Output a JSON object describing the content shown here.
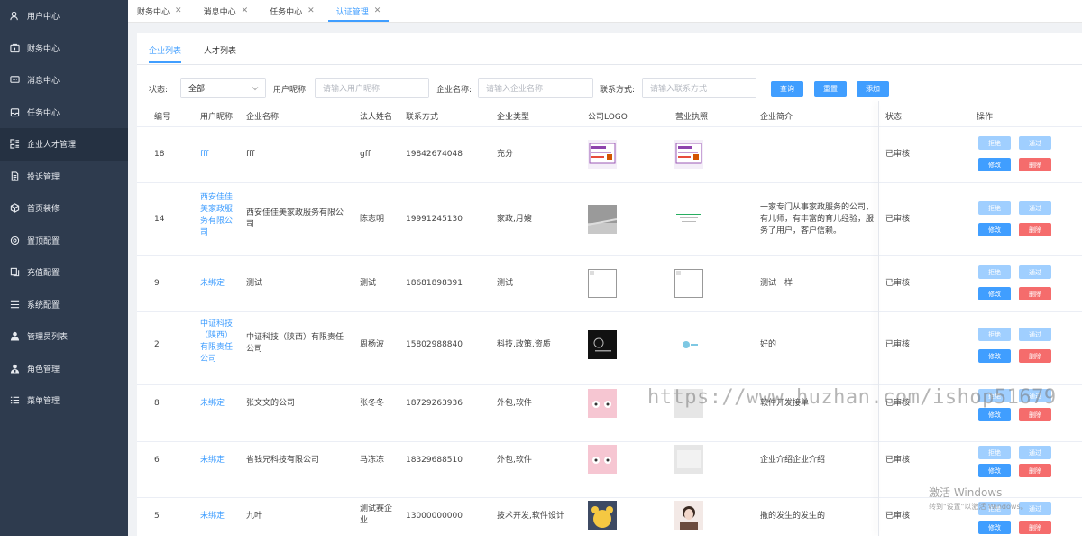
{
  "sidebar": {
    "items": [
      {
        "label": "用户中心",
        "icon": "user-icon"
      },
      {
        "label": "财务中心",
        "icon": "wallet-icon"
      },
      {
        "label": "消息中心",
        "icon": "message-icon"
      },
      {
        "label": "任务中心",
        "icon": "inbox-icon"
      },
      {
        "label": "企业人才管理",
        "icon": "grid-icon"
      },
      {
        "label": "投诉管理",
        "icon": "document-icon"
      },
      {
        "label": "首页装修",
        "icon": "cube-icon"
      },
      {
        "label": "置顶配置",
        "icon": "gear-icon"
      },
      {
        "label": "充值配置",
        "icon": "copy-icon"
      },
      {
        "label": "系统配置",
        "icon": "list-icon"
      },
      {
        "label": "管理员列表",
        "icon": "person-icon"
      },
      {
        "label": "角色管理",
        "icon": "role-icon"
      },
      {
        "label": "菜单管理",
        "icon": "menu-icon"
      }
    ]
  },
  "tabs": [
    {
      "label": "财务中心"
    },
    {
      "label": "消息中心"
    },
    {
      "label": "任务中心"
    },
    {
      "label": "认证管理"
    }
  ],
  "subtabs": {
    "company": "企业列表",
    "talent": "人才列表"
  },
  "filters": {
    "status_label": "状态:",
    "status_value": "全部",
    "nickname_label": "用户昵称:",
    "nickname_placeholder": "请输入用户昵称",
    "company_label": "企业名称:",
    "company_placeholder": "请输入企业名称",
    "contact_label": "联系方式:",
    "contact_placeholder": "请输入联系方式",
    "query": "查询",
    "reset": "重置",
    "add": "添加"
  },
  "table": {
    "columns": [
      "编号",
      "用户昵称",
      "企业名称",
      "法人姓名",
      "联系方式",
      "企业类型",
      "公司LOGO",
      "营业执照",
      "企业简介",
      "状态",
      "操作"
    ],
    "actions": {
      "reject": "拒绝",
      "pass": "通过",
      "edit": "修改",
      "delete": "删除"
    },
    "rows": [
      {
        "id": "18",
        "nickname": "fff",
        "company": "fff",
        "legal": "gff",
        "phone": "19842674048",
        "type": "充分",
        "intro": "",
        "status": "已审核"
      },
      {
        "id": "14",
        "nickname": "西安佳佳美家政服务有限公司",
        "company": "西安佳佳美家政服务有限公司",
        "legal": "陈志明",
        "phone": "19991245130",
        "type": "家政,月嫂",
        "intro": "一家专门从事家政服务的公司，有儿师，有丰富的育儿经验，服务了用户，客户信赖。",
        "status": "已审核"
      },
      {
        "id": "9",
        "nickname": "未绑定",
        "company": "测试",
        "legal": "测试",
        "phone": "18681898391",
        "type": "测试",
        "intro": "测试一样",
        "status": "已审核"
      },
      {
        "id": "2",
        "nickname": "中证科技（陕西）有限责任公司",
        "company": "中证科技（陕西）有限责任公司",
        "legal": "周杨波",
        "phone": "15802988840",
        "type": "科技,政策,资质",
        "intro": "好的",
        "status": "已审核"
      },
      {
        "id": "8",
        "nickname": "未绑定",
        "company": "张文文的公司",
        "legal": "张冬冬",
        "phone": "18729263936",
        "type": "外包,软件",
        "intro": "软件开发接单",
        "status": "已审核"
      },
      {
        "id": "6",
        "nickname": "未绑定",
        "company": "省钱兄科技有限公司",
        "legal": "马冻冻",
        "phone": "18329688510",
        "type": "外包,软件",
        "intro": "企业介绍企业介绍",
        "status": "已审核"
      },
      {
        "id": "5",
        "nickname": "未绑定",
        "company": "九叶",
        "legal": "测试赛企业",
        "phone": "13000000000",
        "type": "技术开发,软件设计",
        "intro": "撒的发生的发生的",
        "status": "已审核"
      }
    ]
  },
  "watermark": "https://www.huzhan.com/ishop51679",
  "activation": {
    "line1": "激活 Windows",
    "line2": "转到\"设置\"以激活 Windows。"
  },
  "colors": {
    "sidebar_bg": "#2e3b4e",
    "primary": "#409eff",
    "danger": "#f56c6c",
    "primary_light": "#a0cfff"
  }
}
